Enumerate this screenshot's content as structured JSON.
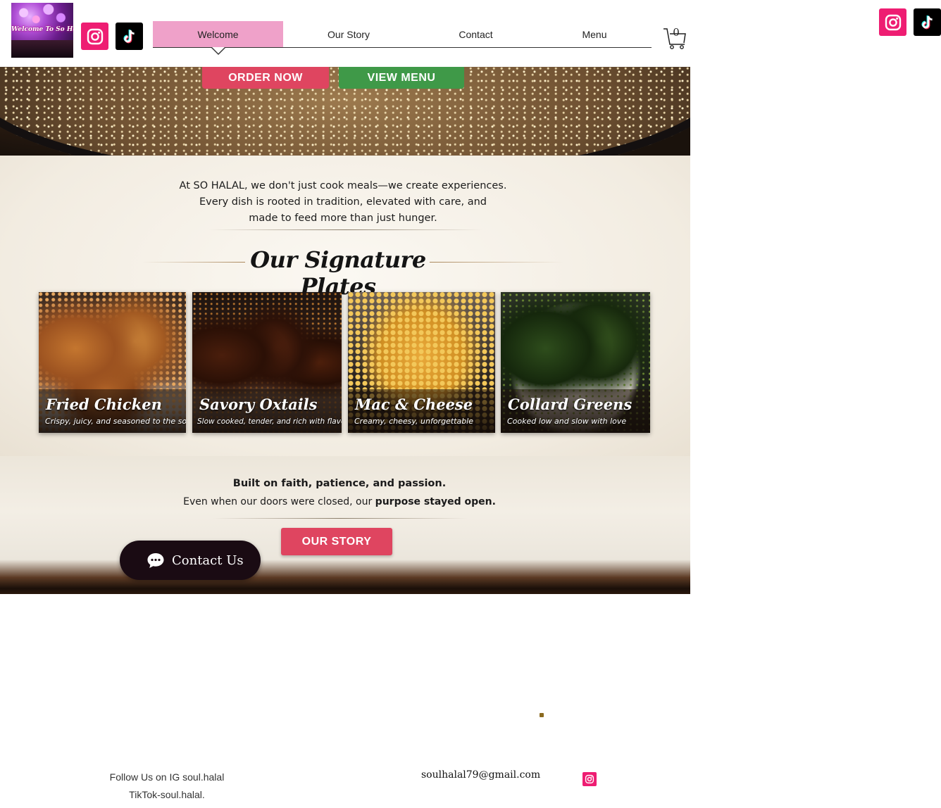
{
  "header": {
    "logo_text": "Welcome To So Halal",
    "nav": [
      {
        "label": "Welcome",
        "active": true
      },
      {
        "label": "Our Story",
        "active": false
      },
      {
        "label": "Contact",
        "active": false
      },
      {
        "label": "Menu",
        "active": false
      }
    ],
    "cart_count": "0",
    "social_icons": [
      "instagram-icon",
      "tiktok-icon"
    ]
  },
  "hero": {
    "order_label": "ORDER NOW",
    "menu_label": "VIEW MENU"
  },
  "intro": {
    "lines": [
      "At SO HALAL, we don't just cook meals—we create experiences.",
      "Every dish is rooted in tradition, elevated with care, and",
      "made to feed more than just hunger."
    ]
  },
  "signature": {
    "title": "Our Signature Plates",
    "plates": [
      {
        "name": "Fried Chicken",
        "desc": "Crispy, juicy, and seasoned to the soul"
      },
      {
        "name": "Savory Oxtails",
        "desc": "Slow cooked, tender, and rich with flavor"
      },
      {
        "name": "Mac & Cheese",
        "desc": "Creamy, cheesy, unforgettable"
      },
      {
        "name": "Collard Greens",
        "desc": "Cooked low and slow with love"
      }
    ]
  },
  "story": {
    "line1": "Built on faith, patience, and passion.",
    "line2_start": "Even when our doors were closed, our ",
    "line2_bold": "purpose stayed open.",
    "button": "OUR STORY"
  },
  "chat": {
    "label": "Contact Us"
  },
  "footer": {
    "follow_ig": "Follow Us on IG soul.halal",
    "tiktok": "TikTok-soul.halal.",
    "email": "soulhalal79@gmail.com"
  },
  "colors": {
    "accent_pink": "#efa1c9",
    "button_red": "#df4560",
    "button_green": "#3f9948",
    "instagram": "#ee1d72",
    "chat_bg": "#1a0b13"
  }
}
